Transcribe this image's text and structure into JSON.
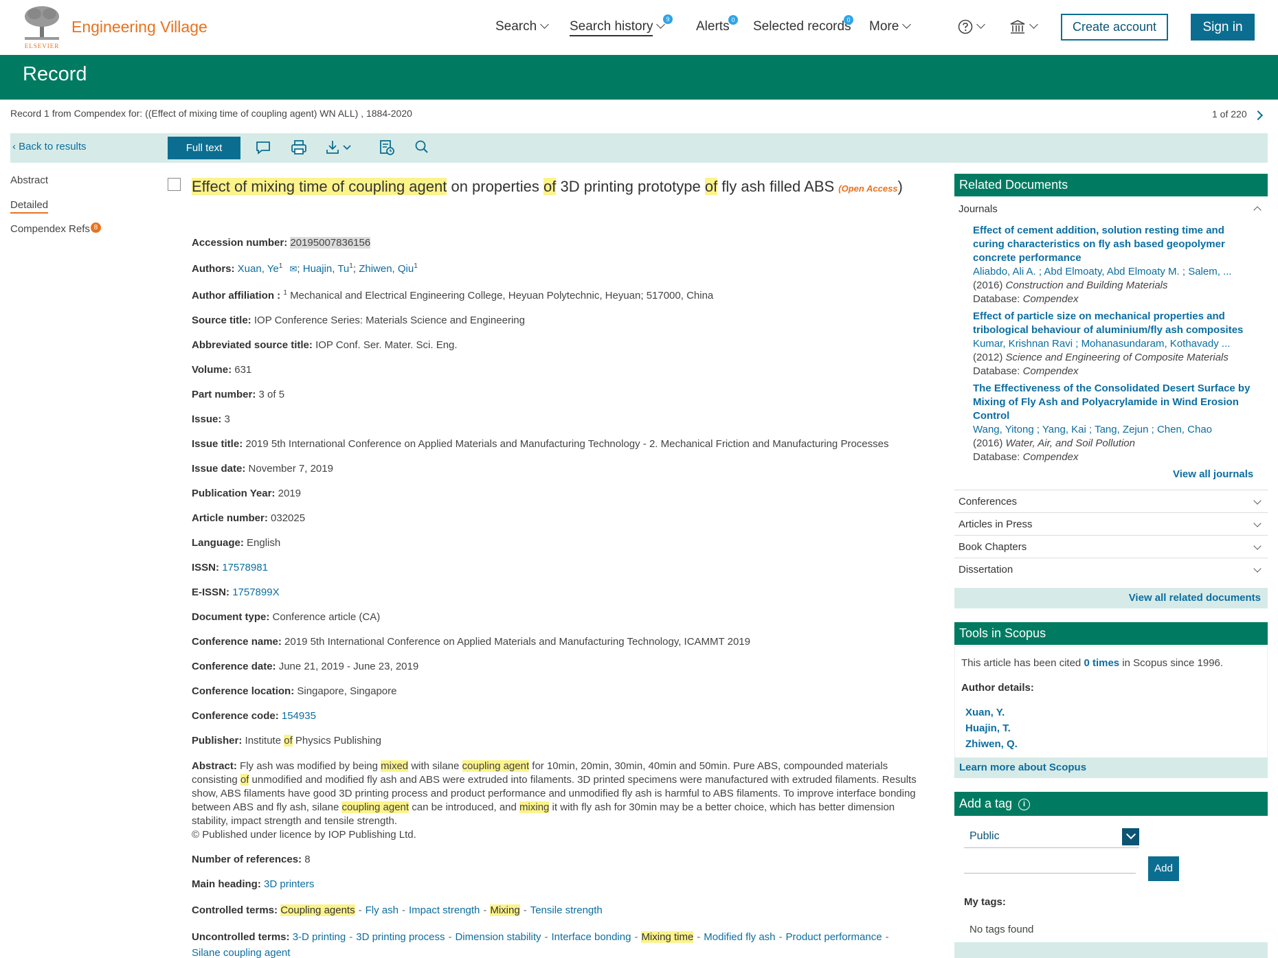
{
  "header": {
    "brand_sub": "ELSEVIER",
    "brand": "Engineering Village",
    "nav": {
      "search": "Search",
      "history": "Search history",
      "history_count": "9",
      "alerts": "Alerts",
      "alerts_count": "0",
      "selected": "Selected records",
      "selected_count": "0",
      "more": "More"
    },
    "create_account": "Create account",
    "sign_in": "Sign in"
  },
  "band": {
    "title": "Record"
  },
  "crumb": "Record 1 from Compendex for: ((Effect of mixing time of coupling agent) WN ALL) , 1884-2020",
  "pager": "1 of 220",
  "toolbar": {
    "back": "Back to results",
    "full_text": "Full text"
  },
  "sidebar": {
    "abstract": "Abstract",
    "detailed": "Detailed",
    "refs": "Compendex Refs",
    "refs_count": "8"
  },
  "record": {
    "title_parts": {
      "p1": "Effect of mixing time of coupling agent",
      "p2": " on properties ",
      "p3": "of",
      "p4": " 3D printing prototype ",
      "p5": "of",
      "p6": " fly ash filled ABS ",
      "oa_open": "(",
      "oa": "Open",
      "oa2": "Access",
      "oa_close": ")"
    },
    "accession_label": "Accession number:",
    "accession": "20195007836156",
    "authors_label": "Authors:",
    "authors": [
      "Xuan, Ye",
      "Huajin, Tu",
      "Zhiwen, Qiu"
    ],
    "author_sup": "1",
    "affiliation_label": "Author affiliation :",
    "affiliation": "Mechanical and Electrical Engineering College, Heyuan Polytechnic, Heyuan; 517000, China",
    "source_label": "Source title:",
    "source": "IOP Conference Series: Materials Science and Engineering",
    "abbrev_label": "Abbreviated source title:",
    "abbrev": "IOP Conf. Ser. Mater. Sci. Eng.",
    "volume_label": "Volume:",
    "volume": "631",
    "part_label": "Part number:",
    "part": "3 of 5",
    "issue_label": "Issue:",
    "issue": "3",
    "issue_title_label": "Issue title:",
    "issue_title": "2019 5th International Conference on Applied Materials and Manufacturing Technology - 2. Mechanical Friction and Manufacturing Processes",
    "issue_date_label": "Issue date:",
    "issue_date": "November 7, 2019",
    "pub_year_label": "Publication Year:",
    "pub_year": "2019",
    "article_num_label": "Article number:",
    "article_num": "032025",
    "language_label": "Language:",
    "language": "English",
    "issn_label": "ISSN:",
    "issn": "17578981",
    "eissn_label": "E-ISSN:",
    "eissn": "1757899X",
    "doctype_label": "Document type:",
    "doctype": "Conference article (CA)",
    "conf_name_label": "Conference name:",
    "conf_name": "2019 5th International Conference on Applied Materials and Manufacturing Technology, ICAMMT 2019",
    "conf_date_label": "Conference date:",
    "conf_date": "June 21, 2019 - June 23, 2019",
    "conf_loc_label": "Conference location:",
    "conf_loc": "Singapore, Singapore",
    "conf_code_label": "Conference code:",
    "conf_code": "154935",
    "publisher_label": "Publisher:",
    "publisher_a": "Institute ",
    "publisher_b": "of",
    "publisher_c": " Physics Publishing",
    "abstract_label": "Abstract:",
    "abstract": {
      "a1": " Fly ash was modified by being ",
      "a2": "mixed",
      "a3": " with silane ",
      "a4": "coupling agent",
      "a5": " for 10min, 20min, 30min, 40min and 50min. Pure ABS, compounded materials consisting ",
      "a6": "of",
      "a7": " unmodified and modified fly ash and ABS were extruded into filaments. 3D printed specimens were manufactured with extruded filaments. Results show, ABS filaments have good 3D printing process and product performance and unmodified fly ash is harmful to ABS filaments. To improve interface bonding between ABS and fly ash, silane ",
      "a8": "coupling agent",
      "a9": " can be introduced, and ",
      "a10": "mixing",
      "a11": " it with fly ash for 30min may be a better choice, which has better dimension stability, impact strength and tensile strength.",
      "a12": "© Published under licence by IOP Publishing Ltd."
    },
    "num_refs_label": "Number of references:",
    "num_refs": "8",
    "main_heading_label": "Main heading:",
    "main_heading": "3D printers",
    "controlled_label": "Controlled terms:",
    "controlled": [
      "Coupling agents",
      "Fly ash",
      "Impact strength",
      "Mixing",
      "Tensile strength"
    ],
    "uncontrolled_label": "Uncontrolled terms:",
    "uncontrolled": [
      "3-D printing",
      "3D printing process",
      "Dimension stability",
      "Interface bonding",
      "Mixing time",
      "Modified fly ash",
      "Product performance",
      "Silane coupling agent"
    ],
    "sep": "-"
  },
  "related": {
    "title": "Related Documents",
    "journals": "Journals",
    "items": [
      {
        "title": "Effect of cement addition, solution resting time and curing characteristics on fly ash based geopolymer concrete performance",
        "authors": "Aliabdo, Ali A. ; Abd Elmoaty, Abd Elmoaty M. ; Salem, ...",
        "year": "(2016)",
        "journal": "Construction and Building Materials",
        "db_label": "Database:",
        "db": "Compendex"
      },
      {
        "title": "Effect of particle size on mechanical properties and tribological behaviour of aluminium/fly ash composites",
        "authors": "Kumar, Krishnan Ravi ; Mohanasundaram, Kothavady ...",
        "year": "(2012)",
        "journal": "Science and Engineering of Composite Materials",
        "db_label": "Database:",
        "db": "Compendex"
      },
      {
        "title": "The Effectiveness of the Consolidated Desert Surface by Mixing of Fly Ash and Polyacrylamide in Wind Erosion Control",
        "authors": "Wang, Yitong ; Yang, Kai ; Tang, Zejun ; Chen, Chao",
        "year": "(2016)",
        "journal": "Water, Air, and Soil Pollution",
        "db_label": "Database:",
        "db": "Compendex"
      }
    ],
    "view_journals": "View all journals",
    "conferences": "Conferences",
    "aip": "Articles in Press",
    "book_chapters": "Book Chapters",
    "dissertation": "Dissertation",
    "view_all": "View all related documents"
  },
  "scopus": {
    "title": "Tools in Scopus",
    "cited_a": "This article has been cited ",
    "cited_b": "0 times",
    "cited_c": " in Scopus since 1996.",
    "author_details": "Author details:",
    "authors": [
      "Xuan, Y.",
      "Huajin, T.",
      "Zhiwen, Q."
    ],
    "learn": "Learn more about Scopus"
  },
  "tag": {
    "title": "Add a tag",
    "visibility": "Public",
    "add": "Add",
    "my_tags": "My tags:",
    "none": "No tags found"
  }
}
